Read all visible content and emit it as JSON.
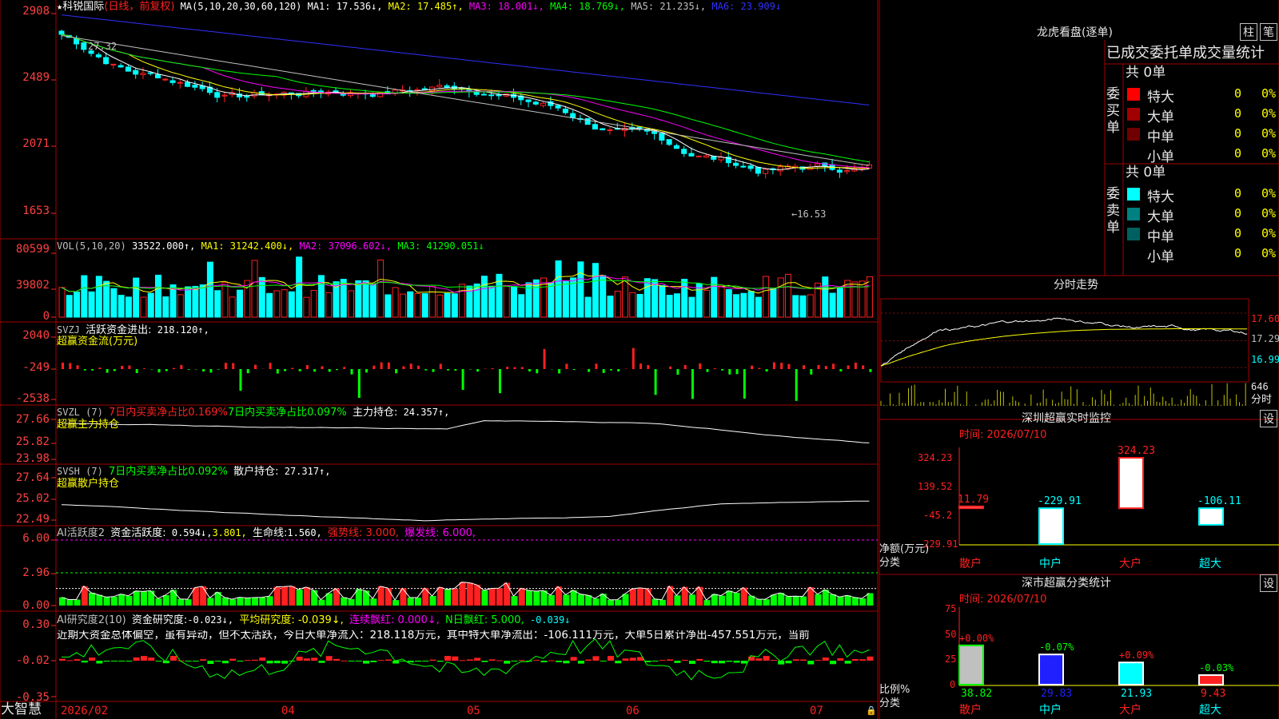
{
  "app": {
    "name": "大智慧",
    "date_start": "2026/02"
  },
  "stock": {
    "name": "科锐国际",
    "period": "(日线，前复权)",
    "ma_title": "MA(5,10,20,30,60,120)",
    "ma": [
      {
        "label": "MA1:",
        "value": "17.536",
        "arrow": "↓",
        "color": "#ffffff"
      },
      {
        "label": "MA2:",
        "value": "17.485",
        "arrow": "↑",
        "color": "#ffff00"
      },
      {
        "label": "MA3:",
        "value": "18.001",
        "arrow": "↓",
        "color": "#ff00ff"
      },
      {
        "label": "MA4:",
        "value": "18.769",
        "arrow": "↓",
        "color": "#00ff00"
      },
      {
        "label": "MA5:",
        "value": "21.235",
        "arrow": "↓",
        "color": "#c0c0c0"
      },
      {
        "label": "MA6:",
        "value": "23.909",
        "arrow": "↓",
        "color": "#3030ff"
      }
    ],
    "price_ticks": [
      "2908",
      "2489",
      "2071",
      "1653"
    ],
    "high_label": "27.32",
    "low_label": "←16.53",
    "colors": {
      "up": "#ff2020",
      "down": "#00ffff",
      "ma1": "#ffffff",
      "ma2": "#ffff00",
      "ma3": "#ff00ff",
      "ma4": "#00ff00",
      "ma5": "#c0c0c0",
      "ma6": "#3030ff"
    }
  },
  "vol": {
    "title": "VOL(5,10,20)",
    "value": "33522.000↑,",
    "ma": [
      {
        "label": "MA1:",
        "value": "31242.400↓,",
        "color": "#ffff00"
      },
      {
        "label": "MA2:",
        "value": "37096.602↓,",
        "color": "#ff00ff"
      },
      {
        "label": "MA3:",
        "value": "41290.051↓",
        "color": "#00ff00"
      }
    ],
    "ticks": [
      "80599",
      "39802",
      "0"
    ]
  },
  "svzj": {
    "title": "SVZJ",
    "label": "活跃资金进出:",
    "value": "218.120↑,",
    "subtitle": "超赢资金流(万元)",
    "ticks": [
      "2040",
      "-249",
      "-2538"
    ]
  },
  "svzl": {
    "title": "SVZL (7)",
    "text1": "7日内买卖净占比0.169%",
    "text2": "7日内买卖净占比0.097%",
    "label": "主力持仓:",
    "value": "24.357↑,",
    "subtitle": "超赢主力持仓",
    "ticks": [
      "27.66",
      "25.82",
      "23.98"
    ]
  },
  "svsh": {
    "title": "SVSH (7)",
    "text1": "7日内买卖净占比0.092%",
    "label": "散户持仓:",
    "value": "27.317↑,",
    "subtitle": "超赢散户持仓",
    "ticks": [
      "27.64",
      "25.02",
      "22.49"
    ]
  },
  "ai_active": {
    "title": "AI活跃度2",
    "label": "资金活跃度:",
    "v1": "0.594↓,",
    "v2": "3.801,",
    "label2": "生命线:",
    "v3": "1.560,",
    "strong": "强势线: 3.000,",
    "burst": "爆发线: 6.000,",
    "ticks": [
      "6.00",
      "2.96",
      "0.00"
    ]
  },
  "ai_research": {
    "title": "AI研究度2(10)",
    "label": "资金研究度:",
    "v1": "-0.023↓,",
    "avg": "平均研究度: -0.039↓,",
    "cont": "连续飘红: 0.000↓,",
    "nday": "N日飘红: 5.000,",
    "v5": "-0.039↓",
    "comment": "近期大资金总体偏空，虽有异动，但不太活跃，今日大单净流入：218.118万元，其中特大单净流出：-106.111万元，大单5日累计净出-457.551万元，当前",
    "ticks": [
      "0.30",
      "-0.02",
      "-0.35"
    ]
  },
  "x_axis": {
    "labels": [
      "04",
      "05",
      "06",
      "07"
    ]
  },
  "lhb": {
    "title": "龙虎看盘(逐单)",
    "btn1": "柱",
    "btn2": "笔",
    "header": "已成交委托单成交量统计",
    "buy": {
      "label": "委买单",
      "count": "共 0单",
      "rows": [
        {
          "name": "特大",
          "n": "0",
          "p": "0%",
          "color": "#ff0000"
        },
        {
          "name": "大单",
          "n": "0",
          "p": "0%",
          "color": "#a00000"
        },
        {
          "name": "中单",
          "n": "0",
          "p": "0%",
          "color": "#700000"
        },
        {
          "name": "小单",
          "n": "0",
          "p": "0%",
          "color": "#000000"
        }
      ]
    },
    "sell": {
      "label": "委卖单",
      "count": "共 0单",
      "rows": [
        {
          "name": "特大",
          "n": "0",
          "p": "0%",
          "color": "#00ffff"
        },
        {
          "name": "大单",
          "n": "0",
          "p": "0%",
          "color": "#008080"
        },
        {
          "name": "中单",
          "n": "0",
          "p": "0%",
          "color": "#006060"
        },
        {
          "name": "小单",
          "n": "0",
          "p": "0%",
          "color": "#000000"
        }
      ]
    }
  },
  "intraday": {
    "title": "分时走势",
    "ticks": [
      "17.60",
      "17.29",
      "16.99"
    ],
    "vol_tick": "646",
    "vol_label": "分时"
  },
  "monitor": {
    "title": "深圳超赢实时监控",
    "btn": "设",
    "time": "时间: 2026/07/10",
    "ticks": [
      "324.23",
      "139.52",
      "-45.2",
      "-229.91"
    ],
    "ylabel": "净额(万元)",
    "xlabel": "分类",
    "cats": [
      "散户",
      "中户",
      "大户",
      "超大"
    ],
    "values": [
      11.79,
      -229.91,
      324.23,
      -106.11
    ],
    "value_labels": [
      "11.79",
      "-229.91",
      "324.23",
      "-106.11"
    ]
  },
  "classify": {
    "title": "深市超赢分类统计",
    "btn": "设",
    "time": "时间: 2026/07/10",
    "ticks": [
      "75",
      "50",
      "25",
      "0"
    ],
    "ylabel": "比例%",
    "xlabel": "分类",
    "cats": [
      "散户",
      "中户",
      "大户",
      "超大"
    ],
    "values": [
      38.82,
      29.83,
      21.93,
      9.43
    ],
    "value_labels": [
      "38.82",
      "29.83",
      "21.93",
      "9.43"
    ],
    "change_labels": [
      "+0.00%",
      "-0.07%",
      "+0.09%",
      "-0.03%"
    ]
  }
}
